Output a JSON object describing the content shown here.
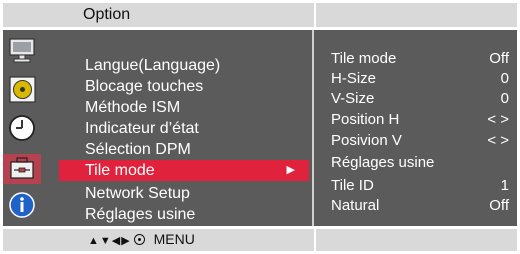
{
  "header": {
    "title": "Option"
  },
  "sidebar": {
    "icons": [
      "monitor-icon",
      "audio-disc-icon",
      "clock-icon",
      "toolbox-icon",
      "info-icon"
    ],
    "active_index": 3
  },
  "menu": {
    "items": [
      {
        "label": "Langue(Language)"
      },
      {
        "label": "Blocage touches"
      },
      {
        "label": "Méthode ISM"
      },
      {
        "label": "Indicateur d’état"
      },
      {
        "label": "Sélection DPM"
      },
      {
        "label": "Tile mode",
        "selected": true,
        "arrow": "▶"
      },
      {
        "label": "Network Setup"
      },
      {
        "label": "Réglages usine"
      }
    ]
  },
  "settings": {
    "items": [
      {
        "label": "Tile mode",
        "value": "Off"
      },
      {
        "label": "H-Size",
        "value": "0"
      },
      {
        "label": "V-Size",
        "value": "0"
      },
      {
        "label": "Position H",
        "value": "< >"
      },
      {
        "label": "Posivion V",
        "value": "< >"
      },
      {
        "label": "Réglages usine",
        "value": ""
      },
      {
        "label": "Tile ID",
        "value": "1"
      },
      {
        "label": "Natural",
        "value": "Off"
      }
    ]
  },
  "footer": {
    "nav_arrows": "▲▼◀▶",
    "menu_label": "MENU"
  },
  "colors": {
    "selection": "#e0223c",
    "active_icon_bg": "#b5424e",
    "panel": "#5b5b5b",
    "bar": "#d9d9d9"
  }
}
